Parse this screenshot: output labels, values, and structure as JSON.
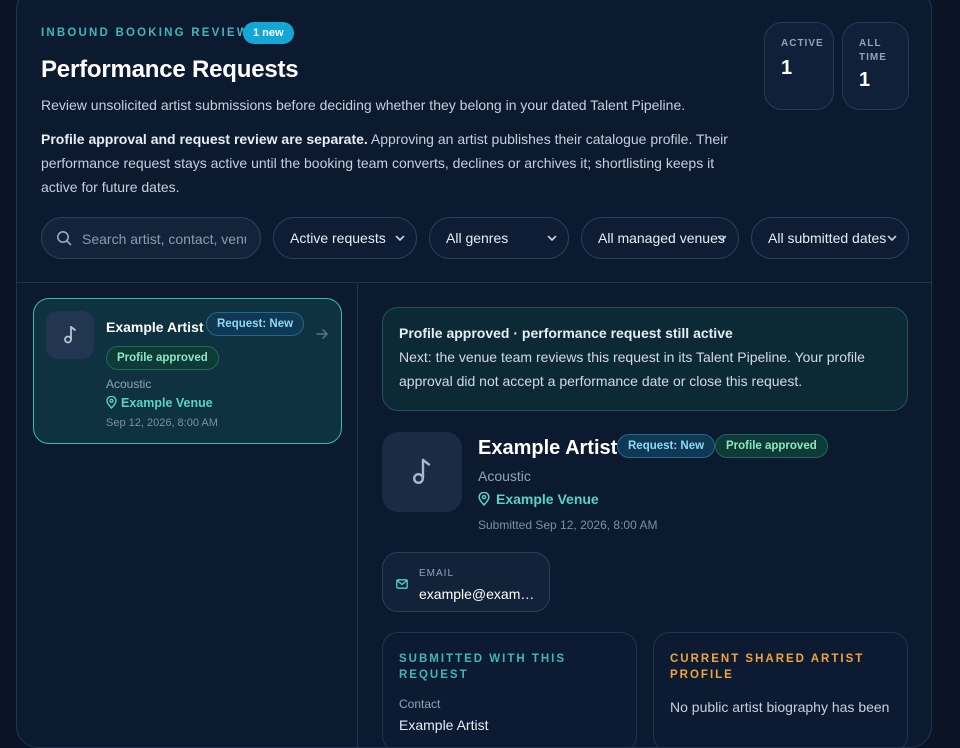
{
  "header": {
    "eyebrow": "INBOUND BOOKING REVIEW",
    "new_badge": "1 new",
    "title": "Performance Requests",
    "subtitle": "Review unsolicited artist submissions before deciding whether they belong in your dated Talent Pipeline.",
    "explain_bold": "Profile approval and request review are separate.",
    "explain_rest": " Approving an artist publishes their catalogue profile. Their performance request stays active until the booking team converts, declines or archives it; shortlisting keeps it active for future dates."
  },
  "stats": [
    {
      "label": "ACTIVE",
      "value": "1"
    },
    {
      "label": "ALL TIME",
      "value": "1"
    }
  ],
  "filters": {
    "search_placeholder": "Search artist, contact, venue",
    "status": "Active requests",
    "genre": "All genres",
    "venue": "All managed venues",
    "date": "All submitted dates"
  },
  "request_list": [
    {
      "name": "Example Artist",
      "status_badge": "Request: New",
      "profile_badge": "Profile approved",
      "genre": "Acoustic",
      "venue": "Example Venue",
      "submitted": "Sep 12, 2026, 8:00 AM"
    }
  ],
  "detail": {
    "notice_title": "Profile approved · performance request still active",
    "notice_text": "Next: the venue team reviews this request in its Talent Pipeline. Your profile approval did not accept a performance date or close this request.",
    "name": "Example Artist",
    "status_badge": "Request: New",
    "profile_badge": "Profile approved",
    "genre": "Acoustic",
    "venue": "Example Venue",
    "submitted": "Submitted Sep 12, 2026, 8:00 AM",
    "email_label": "EMAIL",
    "email_value": "example@example.com",
    "submitted_box": {
      "heading": "SUBMITTED WITH THIS REQUEST",
      "contact_label": "Contact",
      "contact_value": "Example Artist"
    },
    "profile_box": {
      "heading": "CURRENT SHARED ARTIST PROFILE",
      "text": "No public artist biography has been"
    }
  },
  "icons": {
    "search": "search-icon",
    "chevron": "chevron-down-icon",
    "music": "music-note-icon",
    "pin": "map-pin-icon",
    "arrow": "arrow-right-icon",
    "mail": "mail-icon"
  },
  "colors": {
    "accent_teal": "#3fb6b8",
    "venue_teal": "#57d2c7",
    "new_pill": "#14a7d6",
    "amber_heading": "#f0a43a"
  }
}
